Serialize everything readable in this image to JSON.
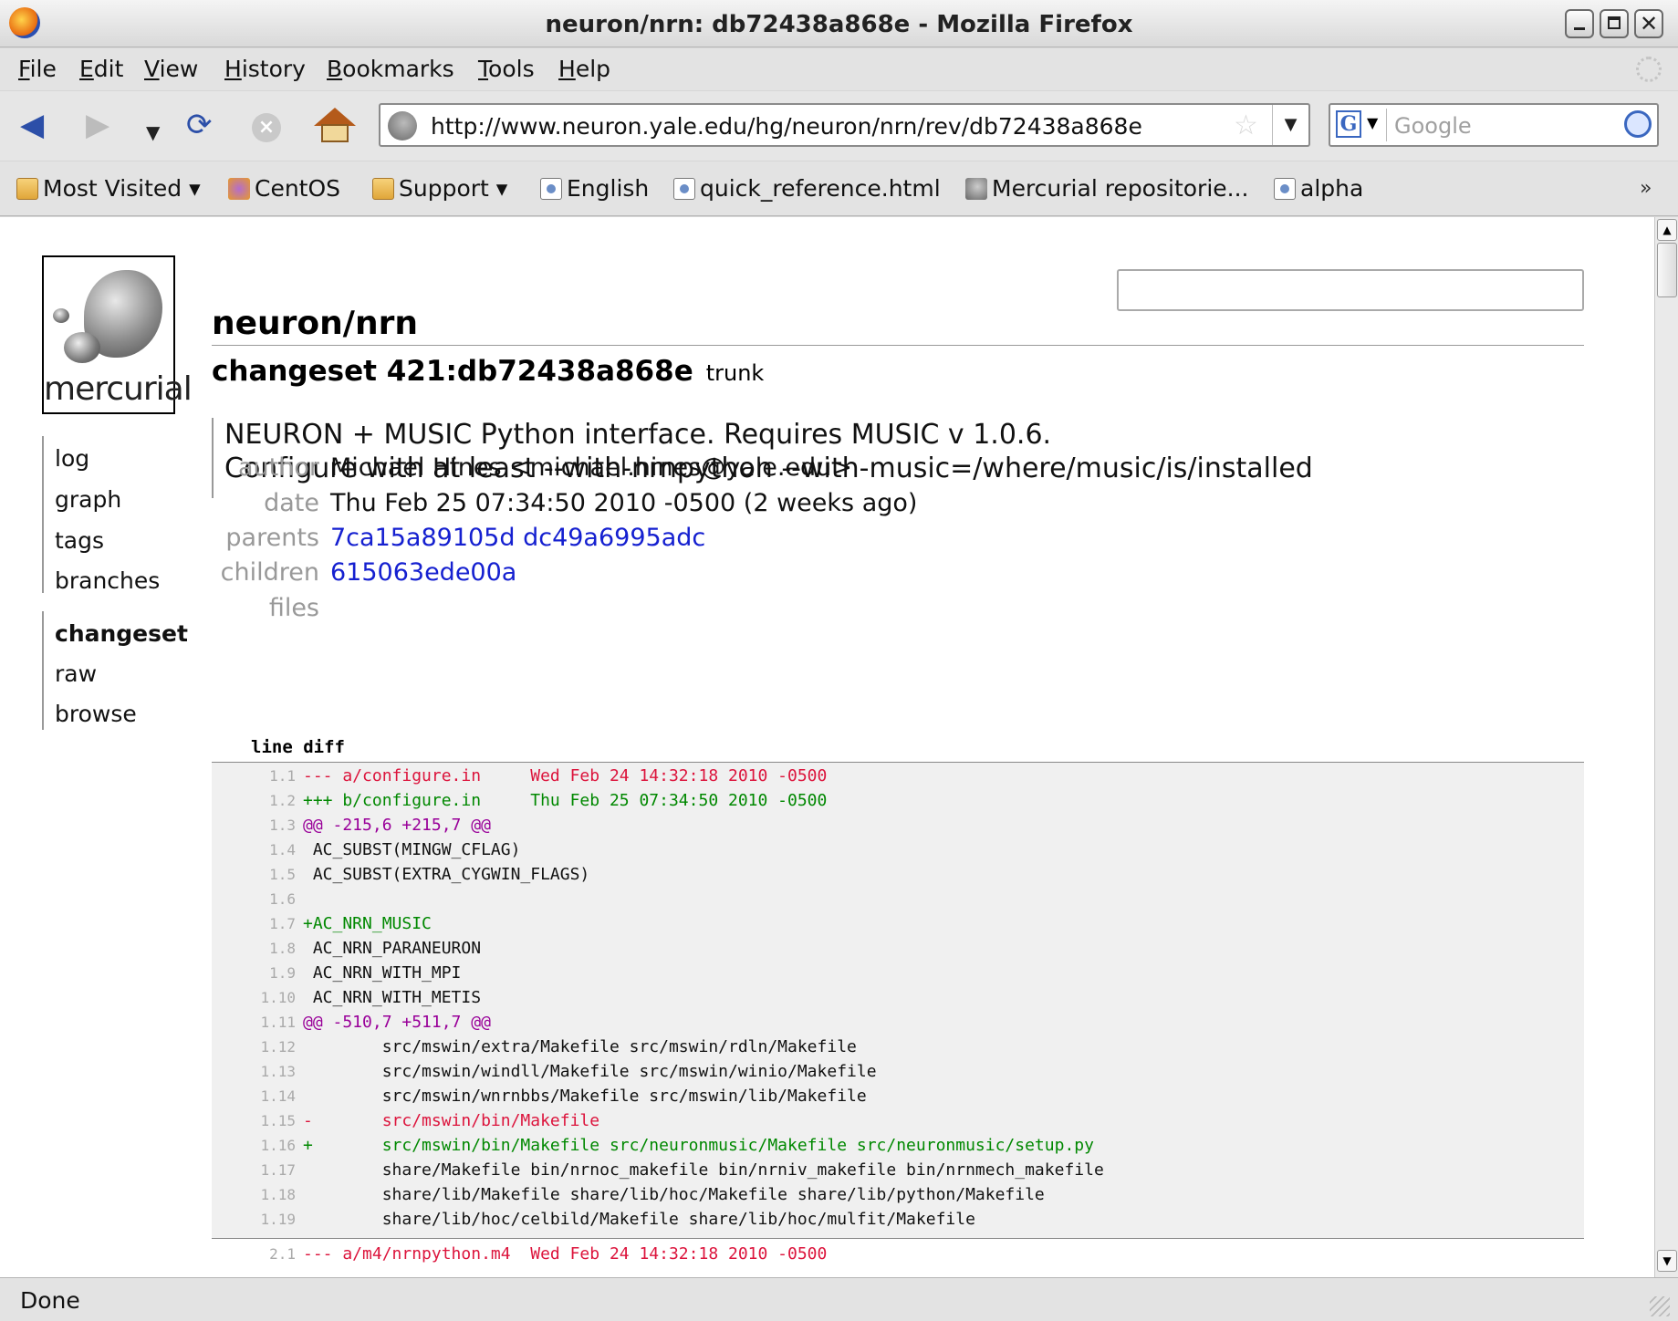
{
  "window": {
    "title": "neuron/nrn: db72438a868e - Mozilla Firefox"
  },
  "menubar": {
    "items": [
      "File",
      "Edit",
      "View",
      "History",
      "Bookmarks",
      "Tools",
      "Help"
    ]
  },
  "navbar": {
    "url": "http://www.neuron.yale.edu/hg/neuron/nrn/rev/db72438a868e",
    "search_placeholder": "Google",
    "icons": [
      "back-icon",
      "forward-icon",
      "history-dropdown-icon",
      "reload-icon",
      "stop-icon",
      "home-icon",
      "star-icon",
      "search-engine-icon",
      "search-go-icon"
    ]
  },
  "bookmarks": {
    "items": [
      "Most Visited ▾",
      "CentOS",
      "Support ▾",
      "English",
      "quick_reference.html",
      "Mercurial repositorie...",
      "alpha"
    ],
    "overflow": "»"
  },
  "sidebar": {
    "logo_text": "mercurial",
    "nav1": [
      "log",
      "graph",
      "tags",
      "branches"
    ],
    "nav2": [
      "changeset",
      "raw",
      "browse"
    ],
    "current": "changeset"
  },
  "header": {
    "repo": "neuron/nrn",
    "changeset": "changeset 421:db72438a868e",
    "branch": "trunk"
  },
  "description": [
    "NEURON + MUSIC Python interface. Requires MUSIC v 1.0.6.",
    "Configure with at least --with-nrnpython --with-music=/where/music/is/installed"
  ],
  "meta": {
    "author_label": "author",
    "author": "Michael Hines <michael.hines@yale.edu>",
    "date_label": "date",
    "date": "Thu Feb 25 07:34:50 2010 -0500 (2 weeks ago)",
    "parents_label": "parents",
    "parents": [
      "7ca15a89105d",
      "dc49a6995adc"
    ],
    "children_label": "children",
    "children": [
      "615063ede00a"
    ],
    "files_label": "files"
  },
  "diff": {
    "label": "line diff",
    "lines": [
      {
        "n": "1.1",
        "t": "--- a/configure.in     Wed Feb 24 14:32:18 2010 -0500",
        "k": "minus"
      },
      {
        "n": "1.2",
        "t": "+++ b/configure.in     Thu Feb 25 07:34:50 2010 -0500",
        "k": "plus"
      },
      {
        "n": "1.3",
        "t": "@@ -215,6 +215,7 @@",
        "k": "atat"
      },
      {
        "n": "1.4",
        "t": " AC_SUBST(MINGW_CFLAG)",
        "k": "ctx"
      },
      {
        "n": "1.5",
        "t": " AC_SUBST(EXTRA_CYGWIN_FLAGS)",
        "k": "ctx"
      },
      {
        "n": "1.6",
        "t": "",
        "k": "ctx"
      },
      {
        "n": "1.7",
        "t": "+AC_NRN_MUSIC",
        "k": "plus"
      },
      {
        "n": "1.8",
        "t": " AC_NRN_PARANEURON",
        "k": "ctx"
      },
      {
        "n": "1.9",
        "t": " AC_NRN_WITH_MPI",
        "k": "ctx"
      },
      {
        "n": "1.10",
        "t": " AC_NRN_WITH_METIS",
        "k": "ctx"
      },
      {
        "n": "1.11",
        "t": "@@ -510,7 +511,7 @@",
        "k": "atat"
      },
      {
        "n": "1.12",
        "t": "        src/mswin/extra/Makefile src/mswin/rdln/Makefile",
        "k": "ctx"
      },
      {
        "n": "1.13",
        "t": "        src/mswin/windll/Makefile src/mswin/winio/Makefile",
        "k": "ctx"
      },
      {
        "n": "1.14",
        "t": "        src/mswin/wnrnbbs/Makefile src/mswin/lib/Makefile",
        "k": "ctx"
      },
      {
        "n": "1.15",
        "t": "-       src/mswin/bin/Makefile",
        "k": "minus"
      },
      {
        "n": "1.16",
        "t": "+       src/mswin/bin/Makefile src/neuronmusic/Makefile src/neuronmusic/setup.py",
        "k": "plus"
      },
      {
        "n": "1.17",
        "t": "        share/Makefile bin/nrnoc_makefile bin/nrniv_makefile bin/nrnmech_makefile",
        "k": "ctx"
      },
      {
        "n": "1.18",
        "t": "        share/lib/Makefile share/lib/hoc/Makefile share/lib/python/Makefile",
        "k": "ctx"
      },
      {
        "n": "1.19",
        "t": "        share/lib/hoc/celbild/Makefile share/lib/hoc/mulfit/Makefile",
        "k": "ctx"
      }
    ],
    "lines2": [
      {
        "n": "2.1",
        "t": "--- a/m4/nrnpython.m4  Wed Feb 24 14:32:18 2010 -0500",
        "k": "minus"
      }
    ]
  },
  "status": {
    "text": "Done"
  }
}
